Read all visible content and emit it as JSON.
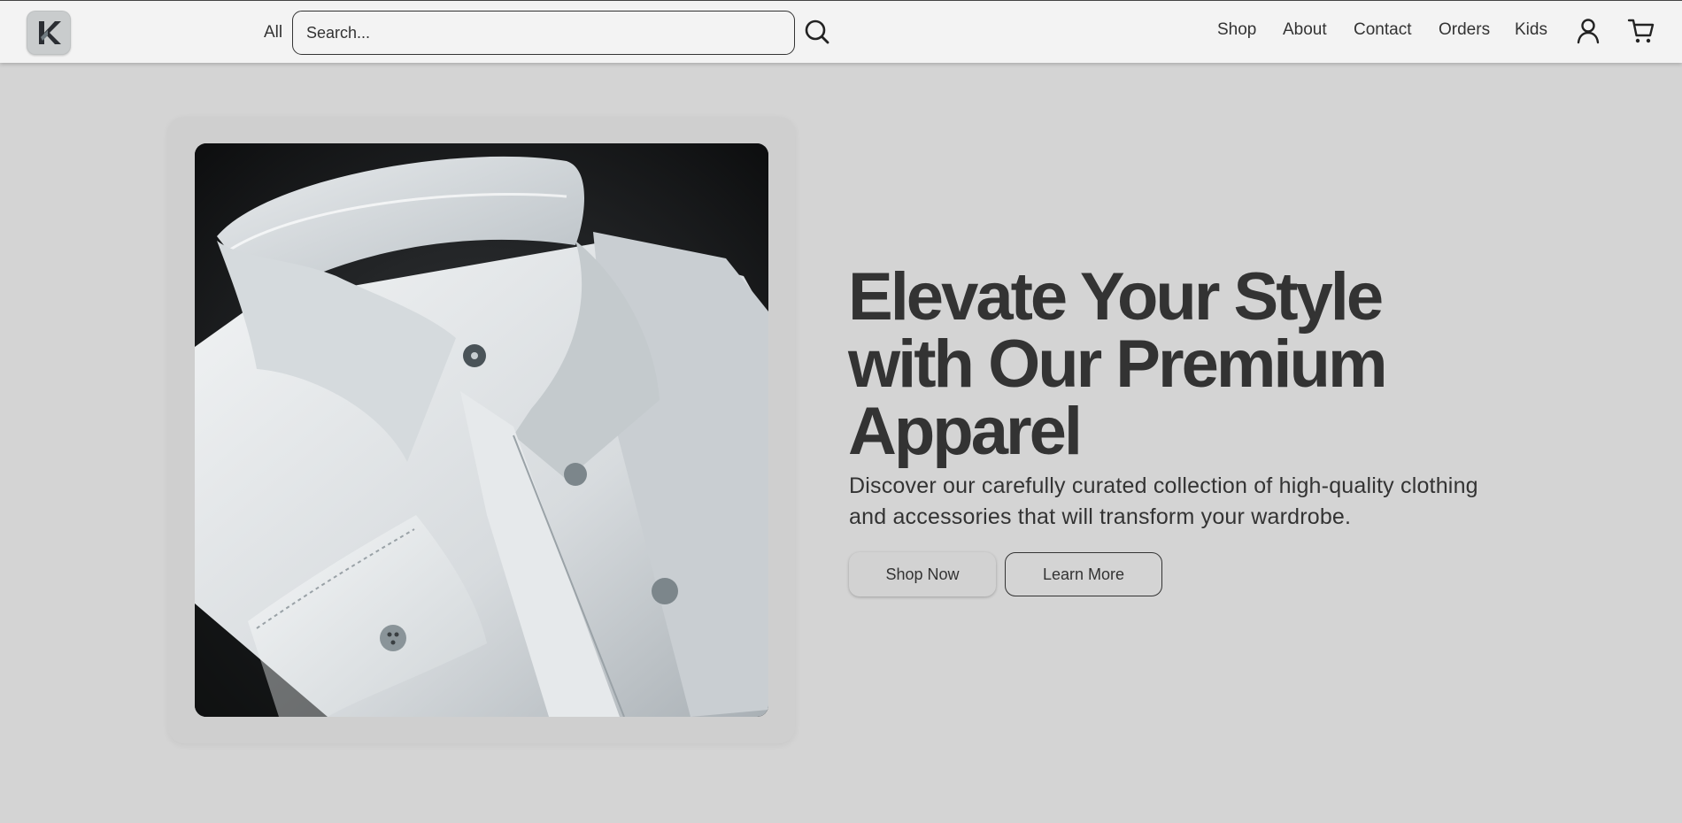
{
  "header": {
    "logo_icon": "k-logo-icon",
    "category_label": "All",
    "search": {
      "placeholder": "Search...",
      "value": ""
    },
    "search_icon": "search-icon",
    "nav": [
      "Shop",
      "About",
      "Contact",
      "Orders",
      "Kids"
    ],
    "account_icon": "user-icon",
    "cart_icon": "cart-icon"
  },
  "hero": {
    "image_subject": "folded white dress shirt",
    "title": "Elevate Your Style with Our Premium Apparel",
    "description": "Discover our carefully curated collection of high-quality clothing and accessories that will transform your wardrobe.",
    "primary_button": "Shop Now",
    "secondary_button": "Learn More"
  },
  "colors": {
    "page_background": "#d4d4d4",
    "header_background": "#f3f3f3",
    "text": "#333333"
  }
}
